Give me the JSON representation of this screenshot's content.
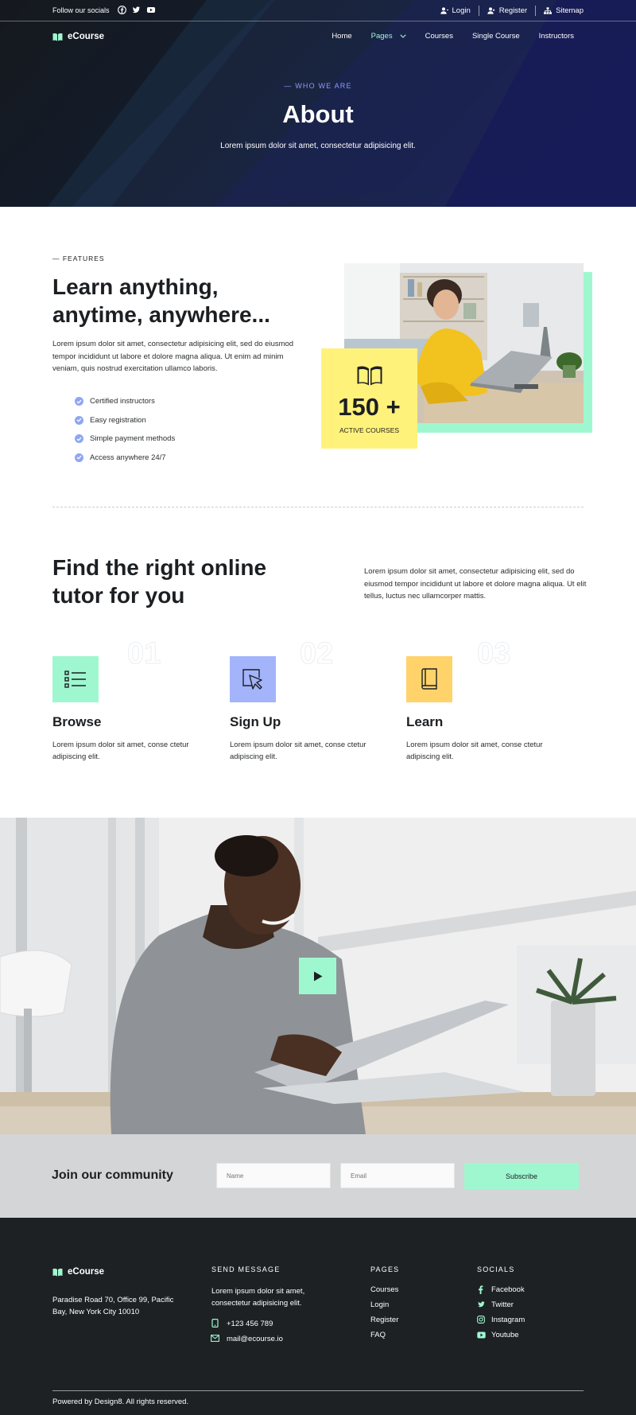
{
  "topbar": {
    "follow_label": "Follow our socials",
    "links": [
      {
        "label": "Login",
        "icon": "user-icon"
      },
      {
        "label": "Register",
        "icon": "user-plus-icon"
      },
      {
        "label": "Sitemap",
        "icon": "sitemap-icon"
      }
    ]
  },
  "brand": {
    "name": "eCourse",
    "accent": "#9ff7d0"
  },
  "nav": {
    "items": [
      "Home",
      "Pages",
      "Courses",
      "Single Course",
      "Instructors"
    ],
    "active": "Pages"
  },
  "hero": {
    "kicker": "— WHO WE ARE",
    "title": "About",
    "subtitle": "Lorem ipsum dolor sit amet, consectetur adipisicing elit."
  },
  "features": {
    "kicker": "— FEATURES",
    "title_line1": "Learn anything,",
    "title_line2": "anytime, anywhere...",
    "paragraph": "Lorem ipsum dolor sit amet, consectetur adipisicing elit, sed do eiusmod tempor incididunt ut labore et dolore magna aliqua. Ut enim ad minim veniam, quis nostrud exercitation ullamco laboris.",
    "list": [
      "Certified instructors",
      "Easy registration",
      "Simple payment methods",
      "Access anywhere 24/7"
    ],
    "stat_value": "150 +",
    "stat_label": "ACTIVE COURSES"
  },
  "tutor": {
    "title_line1": "Find the right online",
    "title_line2": "tutor for you",
    "paragraph": "Lorem ipsum dolor sit amet, consectetur adipisicing elit, sed do eiusmod tempor incididunt ut labore et dolore magna aliqua. Ut elit tellus, luctus nec ullamcorper mattis."
  },
  "steps": [
    {
      "num": "01",
      "title": "Browse",
      "desc": "Lorem ipsum dolor sit amet, conse ctetur adipiscing elit.",
      "color": "#9ff7d0",
      "icon": "list-icon"
    },
    {
      "num": "02",
      "title": "Sign Up",
      "desc": "Lorem ipsum dolor sit amet, conse ctetur adipiscing elit.",
      "color": "#a3b4fb",
      "icon": "cursor-click-icon"
    },
    {
      "num": "03",
      "title": "Learn",
      "desc": "Lorem ipsum dolor sit amet, conse ctetur adipiscing elit.",
      "color": "#ffd36a",
      "icon": "book-icon"
    }
  ],
  "join": {
    "title": "Join our community",
    "name_placeholder": "Name",
    "email_placeholder": "Email",
    "button": "Subscribe"
  },
  "footer": {
    "address": "Paradise Road 70, Office 99, Pacific Bay,  New York City 10010",
    "send_heading": "SEND MESSAGE",
    "send_text": "Lorem ipsum dolor sit amet, consectetur adipisicing elit.",
    "phone": "+123 456 789",
    "email": "mail@ecourse.io",
    "pages_heading": "PAGES",
    "pages": [
      "Courses",
      "Login",
      "Register",
      "FAQ"
    ],
    "socials_heading": "SOCIALS",
    "socials": [
      "Facebook",
      "Twitter",
      "Instagram",
      "Youtube"
    ],
    "copyright": "Powered by Design8. All rights reserved."
  }
}
